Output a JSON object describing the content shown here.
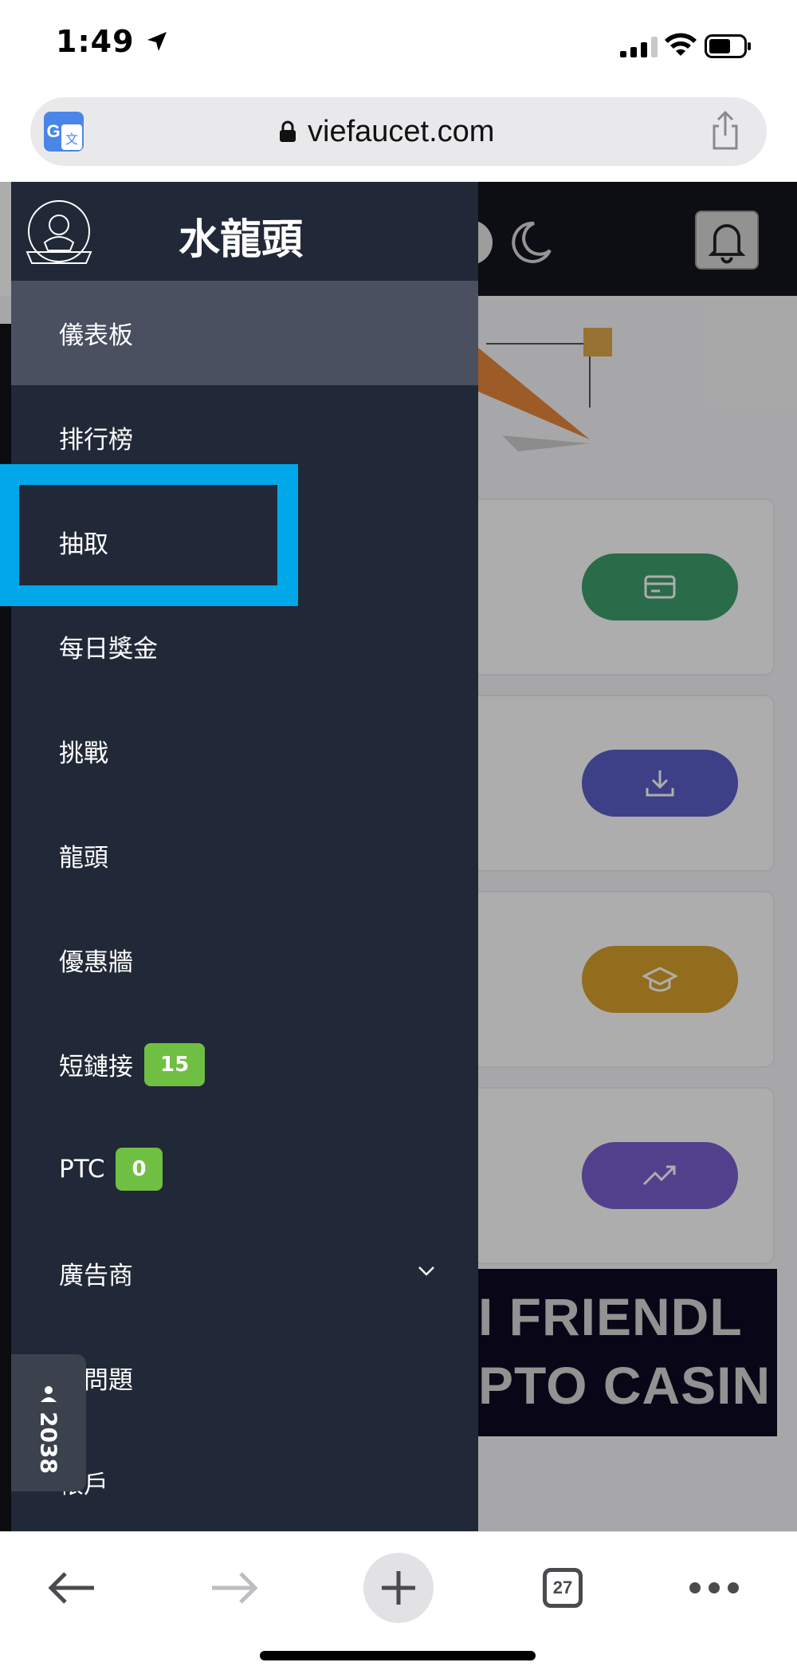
{
  "status_bar": {
    "time": "1:49"
  },
  "address_bar": {
    "url": "viefaucet.com"
  },
  "sidebar": {
    "brand_title": "水龍頭",
    "items": [
      {
        "label": "儀表板",
        "active": true
      },
      {
        "label": "排行榜"
      },
      {
        "label": "抽取",
        "highlighted": true
      },
      {
        "label": "每日獎金"
      },
      {
        "label": "挑戰"
      },
      {
        "label": "龍頭"
      },
      {
        "label": "優惠牆"
      },
      {
        "label": "短鏈接",
        "badge": "15"
      },
      {
        "label": "PTC",
        "badge": "0"
      },
      {
        "label": "廣告商",
        "has_submenu": true
      },
      {
        "label": "問問題"
      },
      {
        "label": "帳戶"
      }
    ]
  },
  "online_counter": {
    "count": "2038"
  },
  "banner": {
    "line1": "I FRIENDL",
    "line2": "PTO CASIN"
  },
  "toolbar": {
    "tab_count": "27"
  },
  "colors": {
    "sidebar_bg": "#212837",
    "active_item_bg": "#4a5060",
    "highlight_border": "#00a8ea",
    "badge_green": "#6fbf43",
    "pill_green": "#3f9e6c",
    "pill_indigo": "#5b5fc7",
    "pill_yellow": "#d8a12c",
    "pill_purple": "#7a5fd0"
  }
}
